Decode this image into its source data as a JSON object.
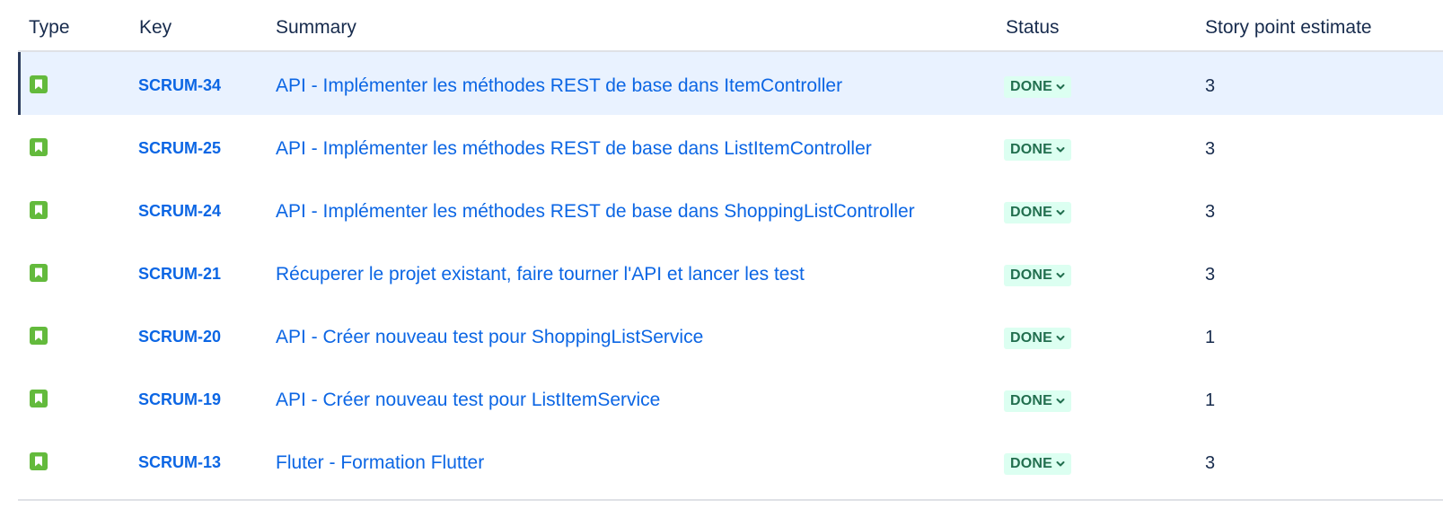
{
  "columns": {
    "type": "Type",
    "key": "Key",
    "summary": "Summary",
    "status": "Status",
    "story_points": "Story point estimate"
  },
  "accent_colors": {
    "link": "#0c66e4",
    "story_icon": "#63ba3c",
    "status_done_bg": "#dcfff1",
    "status_done_text": "#216e4e",
    "selected_row_bg": "#e9f2ff"
  },
  "rows": [
    {
      "icon": "story-icon",
      "key": "SCRUM-34",
      "summary": "API - Implémenter les méthodes REST de base dans ItemController",
      "status": "DONE",
      "story_points": "3",
      "selected": true
    },
    {
      "icon": "story-icon",
      "key": "SCRUM-25",
      "summary": "API - Implémenter les méthodes REST de base dans ListItemController",
      "status": "DONE",
      "story_points": "3",
      "selected": false
    },
    {
      "icon": "story-icon",
      "key": "SCRUM-24",
      "summary": "API - Implémenter les méthodes REST de base dans ShoppingListController",
      "status": "DONE",
      "story_points": "3",
      "selected": false
    },
    {
      "icon": "story-icon",
      "key": "SCRUM-21",
      "summary": "Récuperer le projet existant, faire tourner l'API et lancer les test",
      "status": "DONE",
      "story_points": "3",
      "selected": false
    },
    {
      "icon": "story-icon",
      "key": "SCRUM-20",
      "summary": "API - Créer nouveau test pour ShoppingListService",
      "status": "DONE",
      "story_points": "1",
      "selected": false
    },
    {
      "icon": "story-icon",
      "key": "SCRUM-19",
      "summary": "API - Créer nouveau test pour ListItemService",
      "status": "DONE",
      "story_points": "1",
      "selected": false
    },
    {
      "icon": "story-icon",
      "key": "SCRUM-13",
      "summary": "Fluter - Formation Flutter",
      "status": "DONE",
      "story_points": "3",
      "selected": false
    }
  ]
}
